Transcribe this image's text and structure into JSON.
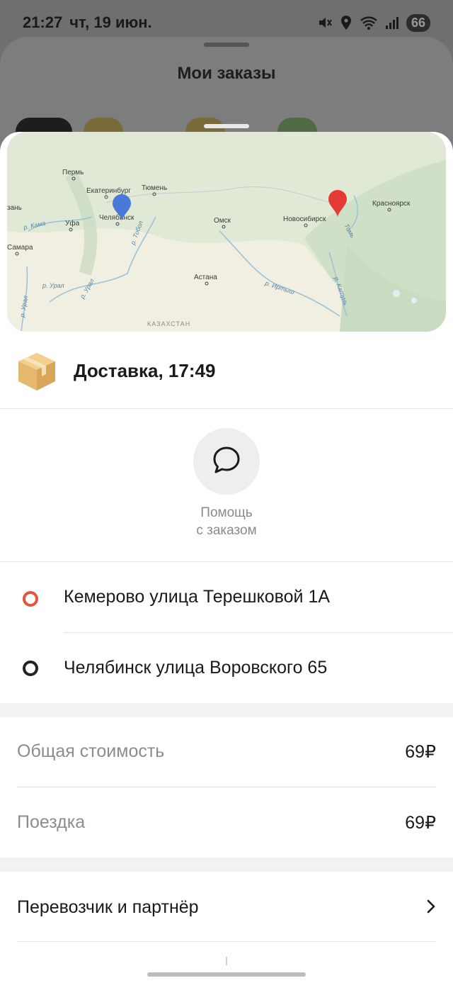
{
  "status_bar": {
    "time": "21:27",
    "date": "чт, 19 июн.",
    "battery": "66"
  },
  "back_sheet": {
    "title": "Мои заказы"
  },
  "map": {
    "cities": [
      "Пермь",
      "Екатеринбург",
      "Тюмень",
      "зань",
      "Уфа",
      "Челябинск",
      "Омск",
      "Новосибирск",
      "Красноярск",
      "Самара",
      "Астана"
    ],
    "rivers": [
      "р. Кама",
      "р. Урал",
      "р. Урал",
      "р. Урал",
      "р. Тобол",
      "р. Иртыш",
      "р. Катунь",
      "Томь"
    ],
    "country": "КАЗАХСТАН",
    "colors": {
      "origin_pin": "#4a78d8",
      "destination_pin": "#e53935"
    }
  },
  "order": {
    "icon": "package-box-icon",
    "title": "Доставка, 17:49"
  },
  "help": {
    "icon": "chat-bubble-icon",
    "label_line1": "Помощь",
    "label_line2": "с заказом"
  },
  "route": {
    "from": "Кемерово улица Терешковой 1А",
    "to": "Челябинск улица Воровского 65",
    "colors": {
      "from_dot": "#e2563f",
      "to_dot": "#222222"
    }
  },
  "cost": {
    "total_label": "Общая стоимость",
    "total_value": "69₽",
    "ride_label": "Поездка",
    "ride_value": "69₽"
  },
  "partner": {
    "label": "Перевозчик и партнёр",
    "icon": "chevron-right-icon"
  }
}
